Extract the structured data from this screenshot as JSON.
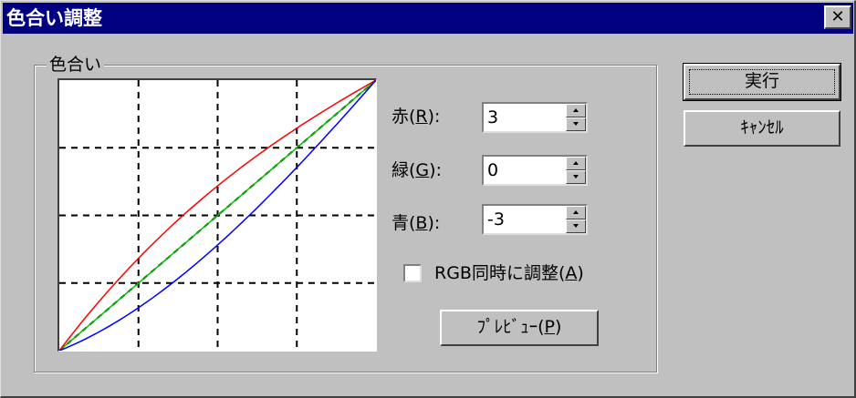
{
  "window": {
    "title": "色合い調整",
    "close_symbol": "✕"
  },
  "group": {
    "label": "色合い"
  },
  "graph": {
    "curves": [
      {
        "name": "red",
        "color": "#ff0000",
        "amount": 3
      },
      {
        "name": "green",
        "color": "#00c000",
        "amount": 0
      },
      {
        "name": "blue",
        "color": "#0000ff",
        "amount": -3
      }
    ],
    "diagonal_color": "#000000",
    "grid_color": "#000000"
  },
  "controls": {
    "red": {
      "label": "赤(",
      "key": "R",
      "suffix": "):",
      "value": "3"
    },
    "green": {
      "label": "緑(",
      "key": "G",
      "suffix": "):",
      "value": "0"
    },
    "blue": {
      "label": "青(",
      "key": "B",
      "suffix": "):",
      "value": "-3"
    },
    "sync": {
      "label": "RGB同時に調整(",
      "key": "A",
      "suffix": ")",
      "checked": false
    },
    "preview": {
      "label": "ﾌﾟﾚﾋﾞｭｰ(",
      "key": "P",
      "suffix": ")"
    }
  },
  "buttons": {
    "execute": "実行",
    "cancel": "ｷｬﾝｾﾙ"
  }
}
